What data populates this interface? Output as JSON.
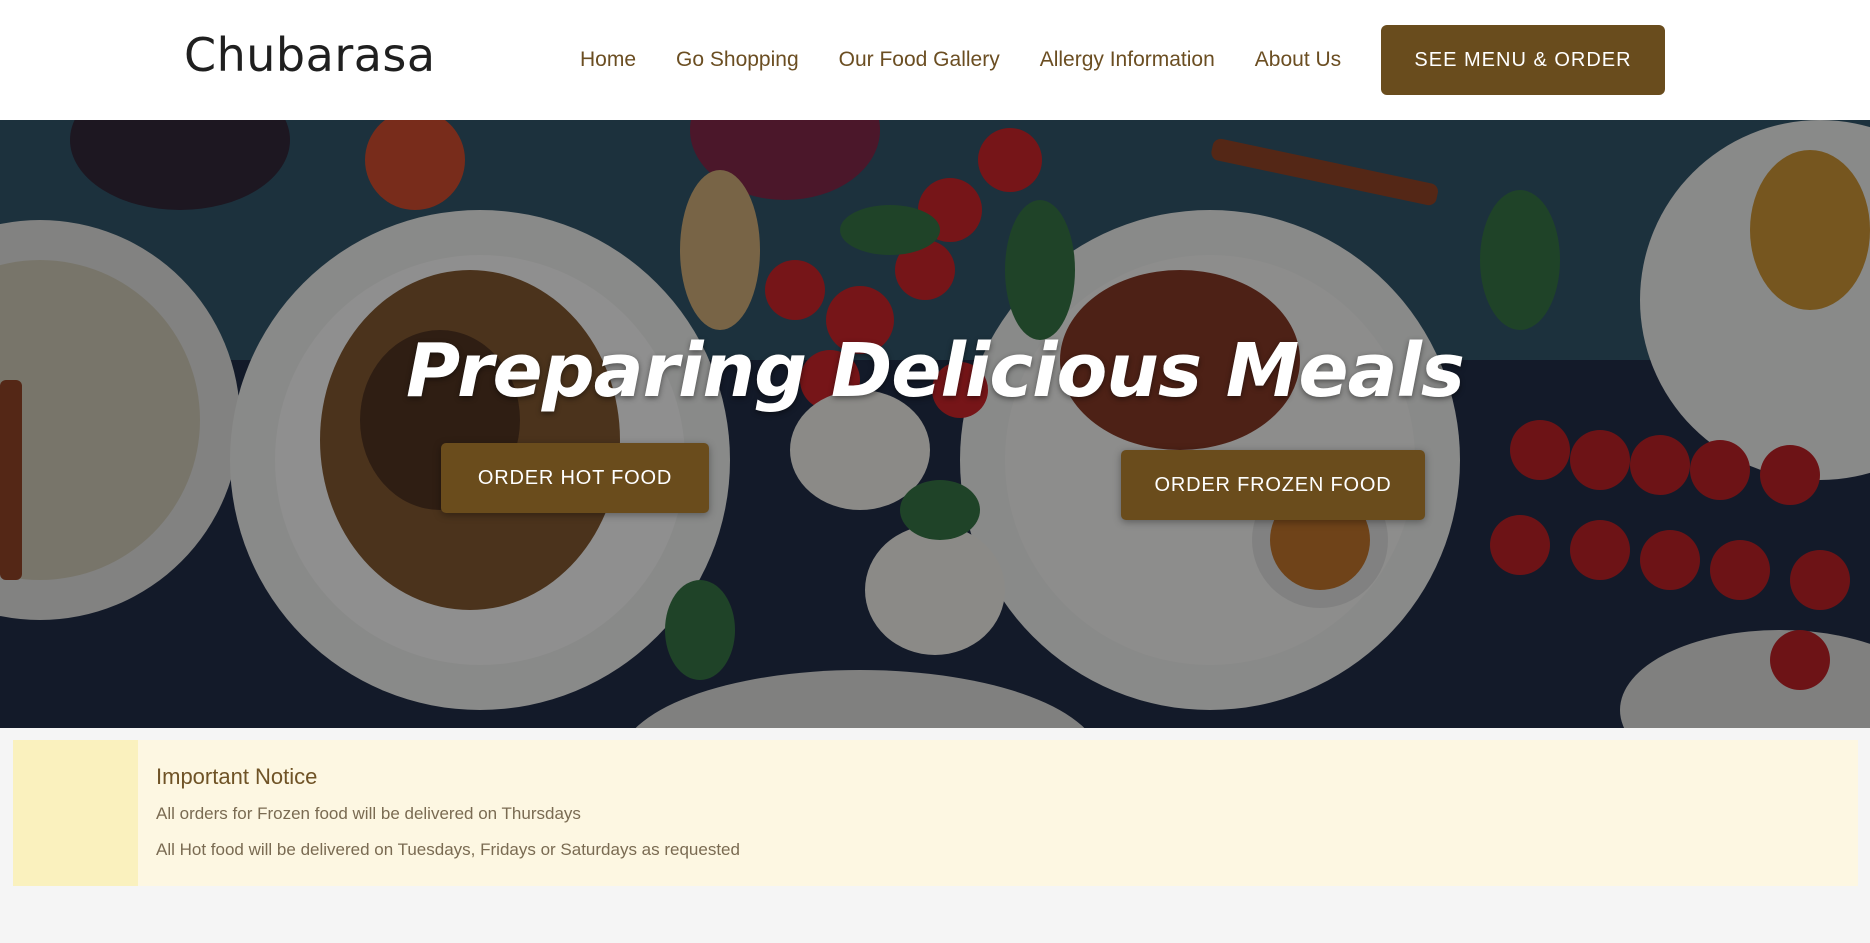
{
  "header": {
    "logo": "Chubarasa",
    "nav": [
      "Home",
      "Go Shopping",
      "Our Food Gallery",
      "Allergy Information",
      "About Us"
    ],
    "cta_label": "SEE MENU & ORDER"
  },
  "hero": {
    "title": "Preparing Delicious Meals",
    "order_hot_label": "ORDER HOT FOOD",
    "order_frozen_label": "ORDER FROZEN FOOD"
  },
  "notice": {
    "title": "Important Notice",
    "lines": [
      "All orders for Frozen food will be delivered on Thursdays",
      "All Hot food will be delivered on Tuesdays, Fridays or Saturdays as requested"
    ]
  },
  "colors": {
    "brand_brown": "#694c1d",
    "nav_text": "#6b4e22",
    "notice_bg": "#fdf7e2",
    "notice_stripe": "#faf1be"
  }
}
